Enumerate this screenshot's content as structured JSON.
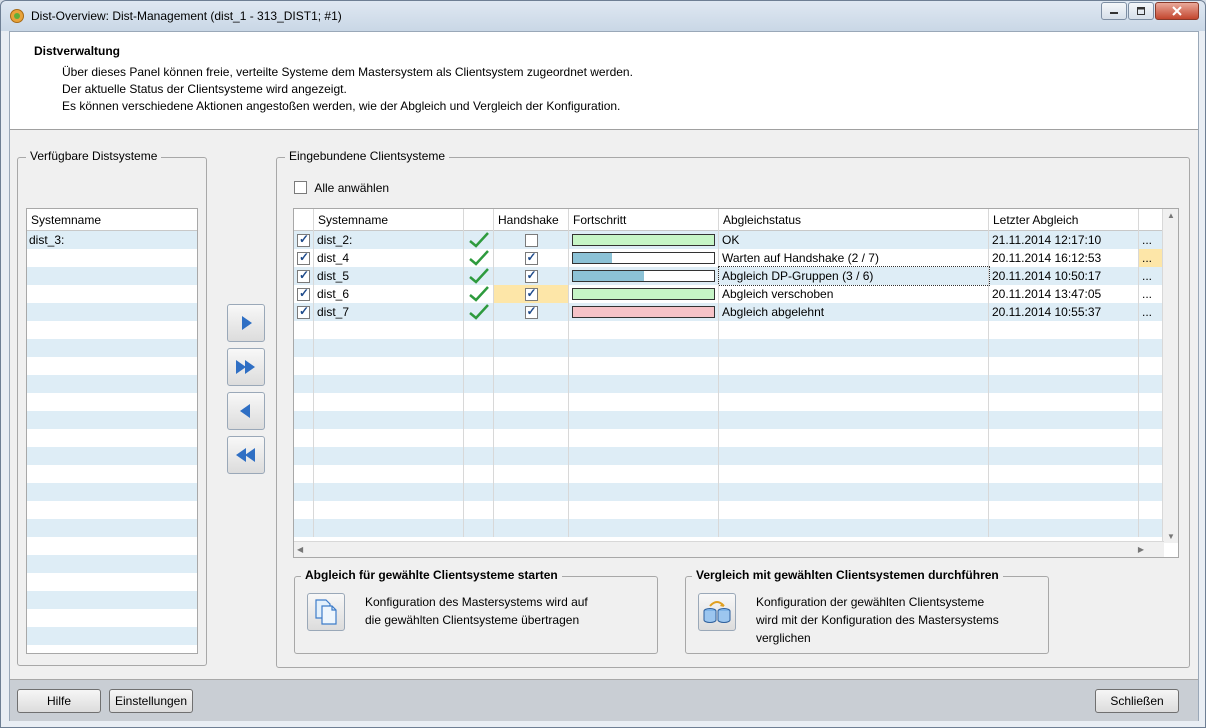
{
  "window": {
    "title": "Dist-Overview: Dist-Management (dist_1 - 313_DIST1; #1)"
  },
  "info": {
    "title": "Distverwaltung",
    "lines": [
      "Über dieses Panel können freie, verteilte Systeme dem Mastersystem als Clientsystem zugeordnet werden.",
      "Der aktuelle Status der Clientsysteme wird angezeigt.",
      "Es können verschiedene Aktionen angestoßen werden, wie der Abgleich und Vergleich der Konfiguration."
    ]
  },
  "available": {
    "legend": "Verfügbare Distsysteme",
    "header": "Systemname",
    "items": [
      "dist_3:"
    ]
  },
  "clients": {
    "legend": "Eingebundene Clientsysteme",
    "select_all": "Alle anwählen",
    "headers": [
      "Systemname",
      "",
      "Handshake",
      "Fortschritt",
      "Abgleichstatus",
      "Letzter Abgleich"
    ],
    "rows": [
      {
        "name": "dist_2:",
        "checked": true,
        "handshake": false,
        "progress": 1.0,
        "progress_color": "#c6f5c6",
        "status": "OK",
        "last": "21.11.2014 12:17:10",
        "more": "...",
        "handshake_highlight": false,
        "more_highlight": false
      },
      {
        "name": "dist_4",
        "checked": true,
        "handshake": true,
        "progress": 0.28,
        "progress_color": "#8cc2d6",
        "status": "Warten auf Handshake (2 / 7)",
        "last": "20.11.2014 16:12:53",
        "more": "...",
        "handshake_highlight": false,
        "more_highlight": true
      },
      {
        "name": "dist_5",
        "checked": true,
        "handshake": true,
        "progress": 0.5,
        "progress_color": "#8cc2d6",
        "status": "Abgleich DP-Gruppen (3 / 6)",
        "last": "20.11.2014 10:50:17",
        "more": "...",
        "handshake_highlight": false,
        "more_highlight": false
      },
      {
        "name": "dist_6",
        "checked": true,
        "handshake": true,
        "progress": 1.0,
        "progress_color": "#c6f5c6",
        "status": "Abgleich verschoben",
        "last": "20.11.2014 13:47:05",
        "more": "...",
        "handshake_highlight": true,
        "more_highlight": false
      },
      {
        "name": "dist_7",
        "checked": true,
        "handshake": true,
        "progress": 1.0,
        "progress_color": "#f6c3c8",
        "status": "Abgleich abgelehnt",
        "last": "20.11.2014 10:55:37",
        "more": "...",
        "handshake_highlight": false,
        "more_highlight": false
      }
    ]
  },
  "actions": {
    "sync": {
      "legend": "Abgleich für gewählte Clientsysteme starten",
      "text": [
        "Konfiguration des Mastersystems wird auf",
        "die gewählten Clientsysteme übertragen"
      ]
    },
    "compare": {
      "legend": "Vergleich mit gewählten Clientsystemen durchführen",
      "text": [
        "Konfiguration der gewählten Clientsysteme",
        "wird mit der Konfiguration des Mastersystems",
        "verglichen"
      ]
    }
  },
  "buttons": {
    "help": "Hilfe",
    "settings": "Einstellungen",
    "close": "Schließen"
  },
  "colors": {
    "row_alt": "#deedf6",
    "highlight": "#fde6a8",
    "check_green": "#2e9b3e",
    "arrow_blue": "#2f6fc4"
  }
}
